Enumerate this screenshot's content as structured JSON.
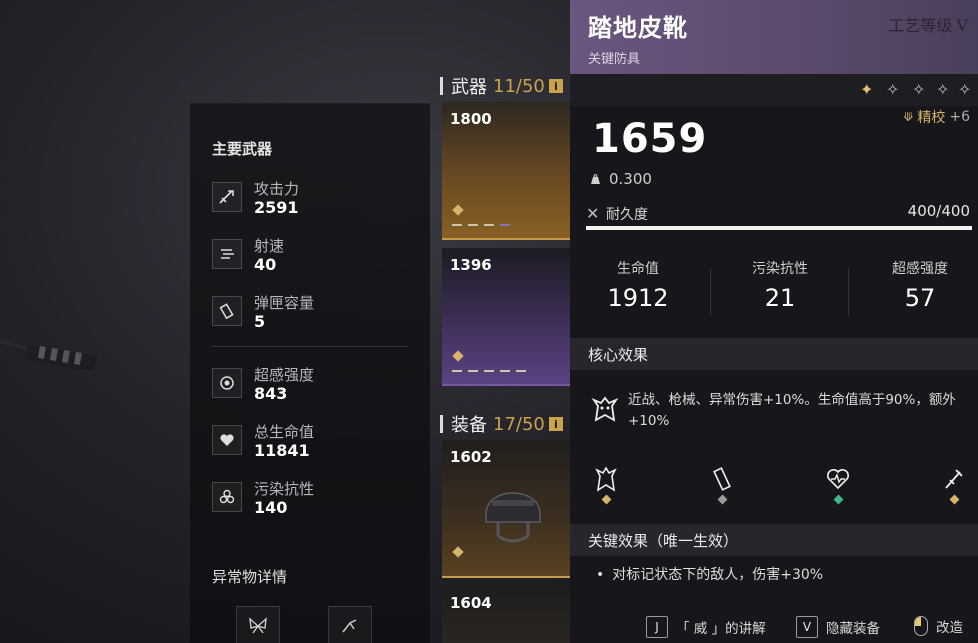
{
  "stats_panel": {
    "title": "主要武器",
    "stats": [
      {
        "icon": "attack-icon",
        "label": "攻击力",
        "value": "2591"
      },
      {
        "icon": "fire-rate-icon",
        "label": "射速",
        "value": "40"
      },
      {
        "icon": "magazine-icon",
        "label": "弹匣容量",
        "value": "5"
      },
      {
        "icon": "sense-icon",
        "label": "超感强度",
        "value": "843"
      },
      {
        "icon": "heart-icon",
        "label": "总生命值",
        "value": "11841"
      },
      {
        "icon": "biohazard-icon",
        "label": "污染抗性",
        "value": "140"
      }
    ],
    "anomaly_title": "异常物详情"
  },
  "inventory": {
    "weapons": {
      "label": "武器",
      "count": "11/50",
      "info": "i"
    },
    "equipment": {
      "label": "装备",
      "count": "17/50",
      "info": "i"
    },
    "weapon_items": [
      {
        "score": "1800",
        "rarity_color": "#c89b4a"
      },
      {
        "score": "1396",
        "rarity_color": "#7a56a6"
      }
    ],
    "equipment_items": [
      {
        "score": "1602",
        "rarity_color": "#c89b4a"
      },
      {
        "score": "1604",
        "rarity_color": "#c89b4a"
      }
    ]
  },
  "detail": {
    "name": "踏地皮靴",
    "type": "关键防具",
    "craft_level_label": "工艺等级",
    "craft_level_value": "V",
    "stars_filled": 1,
    "stars_total": 5,
    "refine_label": "精校",
    "refine_value": "+6",
    "score": "1659",
    "weight": "0.300",
    "durability_label": "耐久度",
    "durability_value": "400/400",
    "durability_fraction": 1.0,
    "substats": [
      {
        "label": "生命值",
        "value": "1912"
      },
      {
        "label": "污染抗性",
        "value": "21"
      },
      {
        "label": "超感强度",
        "value": "57"
      }
    ],
    "core_effect_title": "核心效果",
    "core_effect_text": "近战、枪械、异常伤害+10%。生命值高于90%，额外+10%",
    "core_mini_icons": [
      {
        "icon": "beast-icon",
        "gem_color": "#d8b468"
      },
      {
        "icon": "gun-icon",
        "gem_color": "#9a9a9a"
      },
      {
        "icon": "heartbeat-icon",
        "gem_color": "#3fb58a"
      },
      {
        "icon": "rifle-icon",
        "gem_color": "#d8b468"
      }
    ],
    "key_effect_title": "关键效果（唯一生效）",
    "key_effect_text": "对标记状态下的敌人，伤害+30%",
    "bullet": "•"
  },
  "footer": {
    "hints": [
      {
        "key": "J",
        "label": "「 威 」的讲解"
      },
      {
        "key": "V",
        "label": "隐藏装备"
      },
      {
        "key": "mouse",
        "label": "改造"
      }
    ]
  },
  "colors": {
    "gold": "#d8b468",
    "header_purple": "#6b567e",
    "accent_orange": "#c89b4a"
  }
}
